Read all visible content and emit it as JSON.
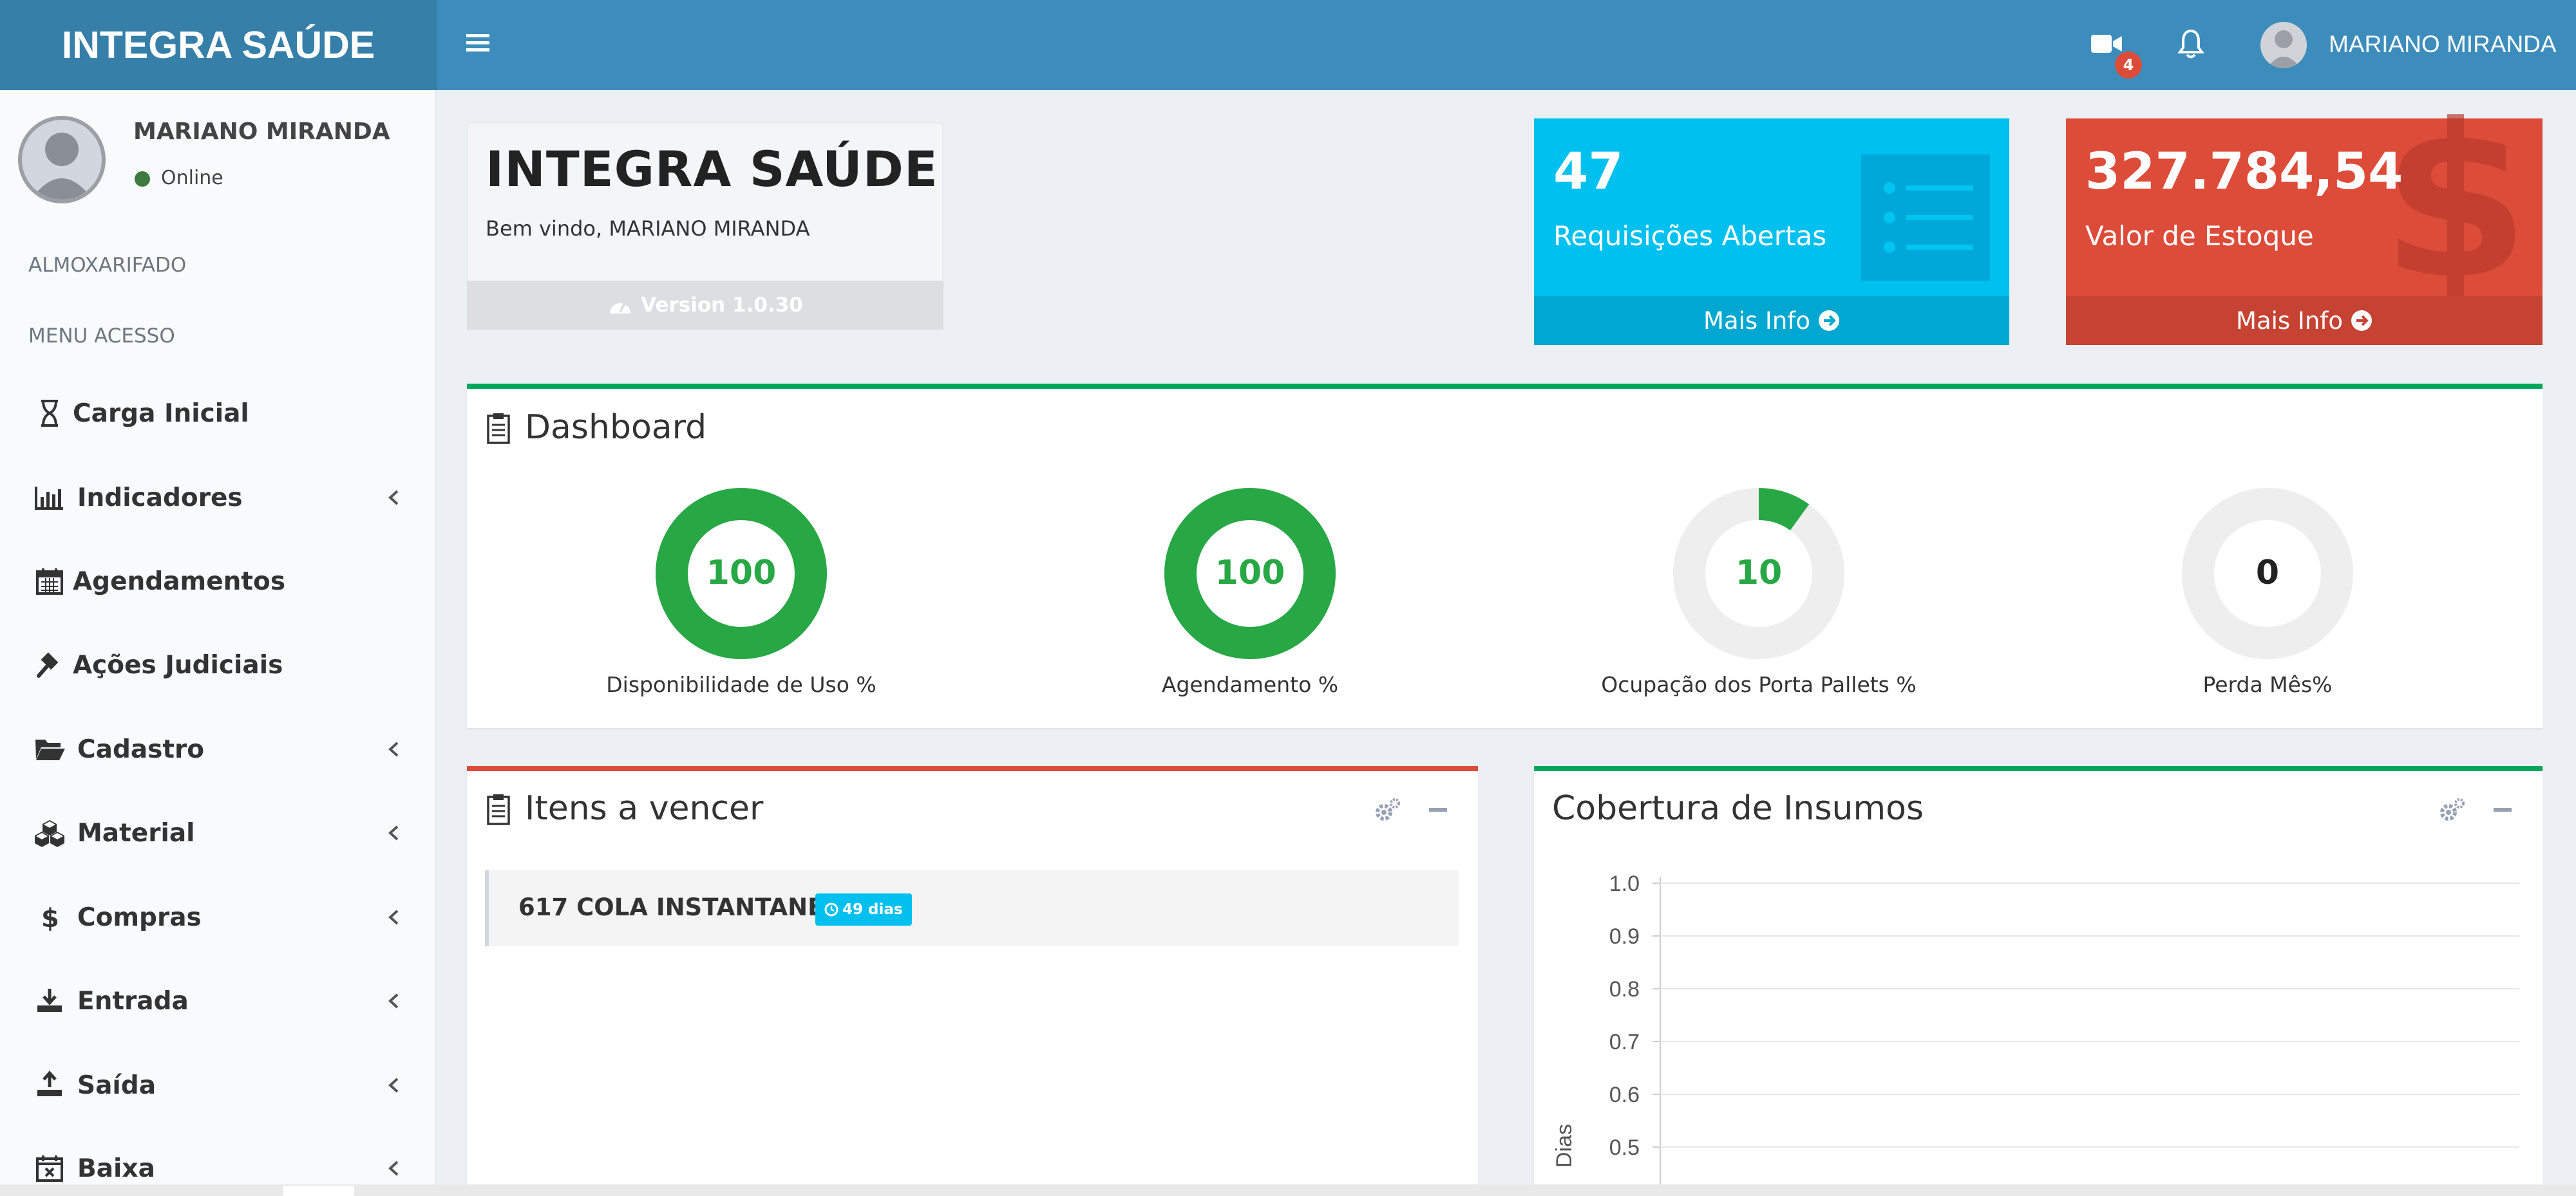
{
  "app": {
    "brand": "INTEGRA SAÚDE",
    "brand_color": "#3c8dbc"
  },
  "header": {
    "video_badge": "4",
    "user_name": "MARIANO MIRANDA"
  },
  "sidebar": {
    "user_name": "MARIANO MIRANDA",
    "status": "Online",
    "section_1": "ALMOXARIFADO",
    "section_2": "MENU ACESSO",
    "items": [
      {
        "label": "Carga Inicial",
        "icon": "hourglass-icon"
      },
      {
        "label": "Indicadores",
        "icon": "bar-chart-icon",
        "has_submenu": true
      },
      {
        "label": "Agendamentos",
        "icon": "calendar-icon"
      },
      {
        "label": "Ações Judiciais",
        "icon": "gavel-icon"
      },
      {
        "label": "Cadastro",
        "icon": "folder-open-icon",
        "has_submenu": true
      },
      {
        "label": "Material",
        "icon": "cubes-icon",
        "has_submenu": true
      },
      {
        "label": "Compras",
        "icon": "dollar-icon",
        "has_submenu": true
      },
      {
        "label": "Entrada",
        "icon": "download-icon",
        "has_submenu": true
      },
      {
        "label": "Saída",
        "icon": "upload-icon",
        "has_submenu": true
      },
      {
        "label": "Baixa",
        "icon": "calendar-x-icon",
        "has_submenu": true
      }
    ]
  },
  "welcome": {
    "title": "INTEGRA SAÚDE",
    "subtitle": "Bem vindo, MARIANO MIRANDA",
    "version": "Version 1.0.30"
  },
  "info_boxes": [
    {
      "value": "47",
      "label": "Requisições Abertas",
      "link": "Mais Info",
      "color": "#00c0ef",
      "footer_color": "#00a7d0"
    },
    {
      "value": "327.784,54",
      "label": "Valor de Estoque",
      "link": "Mais Info",
      "color": "#dd4b39",
      "footer_color": "#c64333"
    }
  ],
  "dashboard": {
    "title": "Dashboard",
    "gauges": [
      {
        "value": 100,
        "label": "Disponibilidade de Uso %"
      },
      {
        "value": 100,
        "label": "Agendamento %"
      },
      {
        "value": 10,
        "label": "Ocupação dos Porta Pallets %"
      },
      {
        "value": 0,
        "label": "Perda Mês%"
      }
    ],
    "gauge_color": "#28a745"
  },
  "itens_vencer": {
    "title": "Itens a vencer",
    "items": [
      {
        "name": "617 COLA INSTANTANEA",
        "badge": "49 dias"
      }
    ]
  },
  "cobertura": {
    "title": "Cobertura de Insumos"
  },
  "chart_data": {
    "type": "line",
    "title": "",
    "xlabel": "",
    "ylabel": "Dias",
    "y_ticks": [
      "1.0",
      "0.9",
      "0.8",
      "0.7",
      "0.6",
      "0.5"
    ],
    "ylim": [
      0.5,
      1.0
    ],
    "series": [],
    "grid": true
  }
}
